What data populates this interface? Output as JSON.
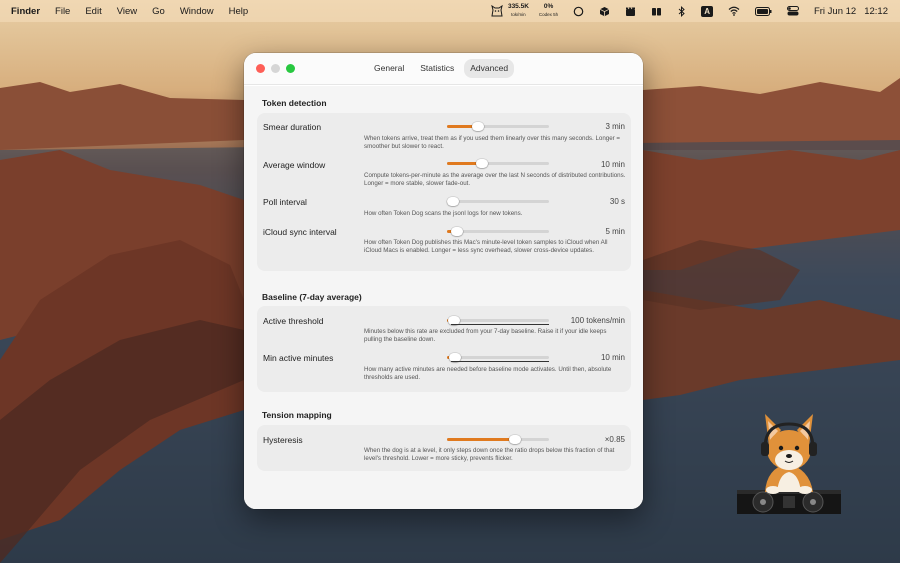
{
  "menubar": {
    "app_name": "Finder",
    "menus": [
      "File",
      "Edit",
      "View",
      "Go",
      "Window",
      "Help"
    ],
    "token_rate_value": "335.5K",
    "token_rate_unit": "tok/min",
    "codex_percent": "0%",
    "codex_label": "Codex 5h",
    "input_source": "A",
    "date": "Fri Jun 12",
    "time": "12:12",
    "icons": [
      "dog-status-icon",
      "circle-icon",
      "cube-icon",
      "clapperboard-icon",
      "book-icon",
      "bluetooth-icon",
      "wifi-icon",
      "battery-icon",
      "control-center-icon"
    ]
  },
  "window": {
    "tabs": [
      "General",
      "Statistics",
      "Advanced"
    ],
    "active_tab": "Advanced",
    "accent_color": "#e07a1f",
    "sections": {
      "token_detection": {
        "title": "Token detection",
        "rows": [
          {
            "label": "Smear duration",
            "value": "3 min",
            "level": 0.3,
            "desc": "When tokens arrive, treat them as if you used them linearly over this many seconds. Longer = smoother but slower to react."
          },
          {
            "label": "Average window",
            "value": "10 min",
            "level": 0.34,
            "desc": "Compute tokens-per-minute as the average over the last N seconds of distributed contributions. Longer = more stable, slower fade-out."
          },
          {
            "label": "Poll interval",
            "value": "30 s",
            "level": 0.05,
            "desc": "How often Token Dog scans the jsonl logs for new tokens."
          },
          {
            "label": "iCloud sync interval",
            "value": "5 min",
            "level": 0.1,
            "desc": "How often Token Dog publishes this Mac's minute-level token samples to iCloud when All iCloud Macs is enabled. Longer = less sync overhead, slower cross-device updates."
          }
        ]
      },
      "baseline": {
        "title": "Baseline (7-day average)",
        "rows": [
          {
            "label": "Active threshold",
            "value": "100 tokens/min",
            "level": 0.07,
            "desc": "Minutes below this rate are excluded from your 7-day baseline. Raise it if your idle keeps pulling the baseline down."
          },
          {
            "label": "Min active minutes",
            "value": "10 min",
            "level": 0.08,
            "desc": "How many active minutes are needed before baseline mode activates. Until then, absolute thresholds are used."
          }
        ]
      },
      "tension": {
        "title": "Tension mapping",
        "rows": [
          {
            "label": "Hysteresis",
            "value": "×0.85",
            "level": 0.67,
            "desc": "When the dog is at a level, it only steps down once the ratio drops below this fraction of that level's threshold. Lower = more sticky, prevents flicker."
          }
        ]
      }
    }
  }
}
